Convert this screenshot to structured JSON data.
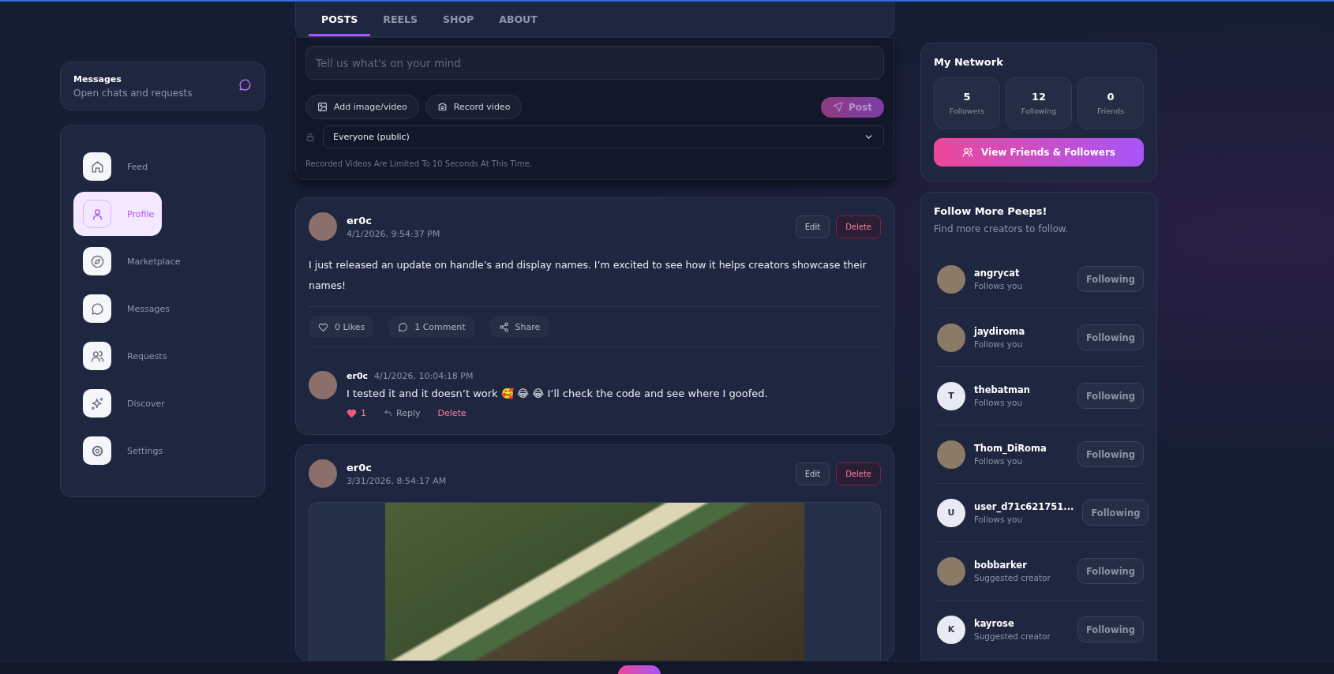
{
  "messages_card": {
    "title": "Messages",
    "subtitle": "Open chats and requests"
  },
  "nav": [
    {
      "label": "Feed",
      "selected": false
    },
    {
      "label": "Profile",
      "selected": true
    },
    {
      "label": "Marketplace",
      "selected": false
    },
    {
      "label": "Messages",
      "selected": false
    },
    {
      "label": "Requests",
      "selected": false
    },
    {
      "label": "Discover",
      "selected": false
    },
    {
      "label": "Settings",
      "selected": false
    }
  ],
  "tabs": [
    {
      "label": "POSTS",
      "selected": true
    },
    {
      "label": "REELS",
      "selected": false
    },
    {
      "label": "SHOP",
      "selected": false
    },
    {
      "label": "ABOUT",
      "selected": false
    }
  ],
  "composer": {
    "placeholder": "Tell us what's on your mind",
    "add_media": "Add image/video",
    "record": "Record video",
    "post": "Post",
    "audience": "Everyone (public)",
    "note": "Recorded Videos Are Limited To 10 Seconds At This Time."
  },
  "posts": [
    {
      "author": "er0c",
      "time": "4/1/2026, 9:54:37 PM",
      "edit": "Edit",
      "delete": "Delete",
      "text": "I just released an update on handle’s and display names. I’m excited to see how it helps creators showcase their names!",
      "likes": "0 Likes",
      "liked": false,
      "comments": "1 Comment",
      "share": "Share",
      "replies": [
        {
          "author": "er0c",
          "time": "4/1/2026, 10:04:18 PM",
          "text": "I tested it and it doesn’t work 🥰 😂 😂  I’ll check the code and see where I goofed.",
          "likes": "1",
          "liked": true,
          "reply": "Reply",
          "delete": "Delete"
        }
      ]
    },
    {
      "author": "er0c",
      "time": "3/31/2026, 8:54:17 AM",
      "edit": "Edit",
      "delete": "Delete",
      "kind": "media"
    }
  ],
  "network": {
    "title": "My Network",
    "stats": [
      {
        "value": "5",
        "label": "Followers"
      },
      {
        "value": "12",
        "label": "Following"
      },
      {
        "value": "0",
        "label": "Friends"
      }
    ],
    "button": "View Friends & Followers"
  },
  "suggestions": {
    "title": "Follow More Peeps!",
    "subtitle": "Find more creators to follow.",
    "people": [
      {
        "name": "angrycat",
        "status": "Follows you",
        "button": "Following",
        "kind": "photo"
      },
      {
        "name": "jaydiroma",
        "status": "Follows you",
        "button": "Following",
        "kind": "photo"
      },
      {
        "name": "thebatman",
        "status": "Follows you",
        "button": "Following",
        "kind": "initial",
        "initial": "T"
      },
      {
        "name": "Thom_DiRoma",
        "status": "Follows you",
        "button": "Following",
        "kind": "photo"
      },
      {
        "name": "user_d71c621751...",
        "status": "Follows you",
        "button": "Following",
        "kind": "initial",
        "initial": "U"
      },
      {
        "name": "bobbarker",
        "status": "Suggested creator",
        "button": "Following",
        "kind": "photo"
      },
      {
        "name": "kayrose",
        "status": "Suggested creator",
        "button": "Following",
        "kind": "initial",
        "initial": "K"
      }
    ]
  }
}
